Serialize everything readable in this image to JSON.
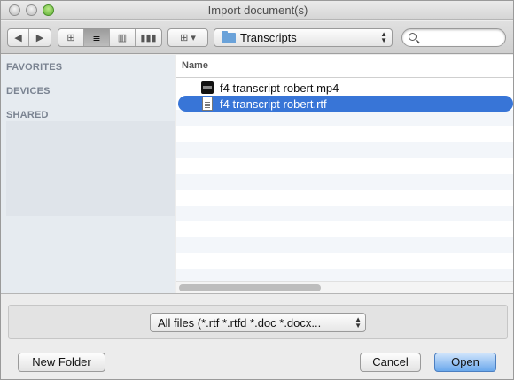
{
  "window": {
    "title": "Import document(s)"
  },
  "toolbar": {
    "nav": {
      "back_icon": "back-arrow-icon",
      "forward_icon": "forward-arrow-icon"
    },
    "view_modes": [
      "icon-view",
      "list-view",
      "column-view",
      "coverflow-view"
    ],
    "active_view": "list-view",
    "arrange_icon": "arrange-grid-icon",
    "path_popup": {
      "label": "Transcripts",
      "icon": "folder-icon"
    },
    "search": {
      "placeholder": "",
      "icon": "search-icon"
    }
  },
  "sidebar": {
    "headers": [
      "FAVORITES",
      "DEVICES",
      "SHARED"
    ]
  },
  "file_list": {
    "column_header": "Name",
    "files": [
      {
        "name": "f4 transcript robert.mp4",
        "icon": "video-file-icon",
        "selected": false
      },
      {
        "name": "f4 transcript robert.rtf",
        "icon": "rtf-document-icon",
        "selected": true
      }
    ]
  },
  "filter": {
    "label": "All files (*.rtf *.rtfd *.doc *.docx..."
  },
  "buttons": {
    "new_folder": "New Folder",
    "cancel": "Cancel",
    "open": "Open"
  },
  "colors": {
    "selection": "#3875d7",
    "default_button": "#6aa8ec"
  }
}
